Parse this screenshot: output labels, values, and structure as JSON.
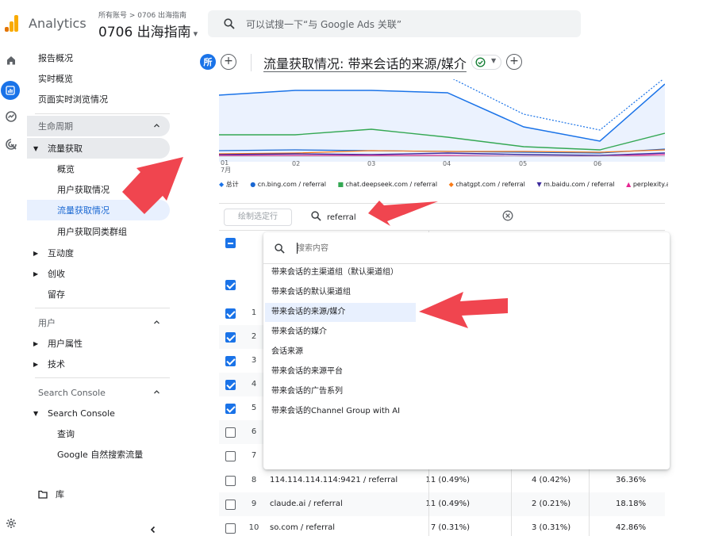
{
  "header": {
    "app_name": "Analytics",
    "breadcrumb": "所有账号 > 0706 出海指南",
    "property": "0706 出海指南",
    "search_placeholder": "可以试搜一下“与 Google Ads 关联”"
  },
  "rail": {
    "icons": [
      "home-icon",
      "reports-icon",
      "explore-icon",
      "advertising-icon"
    ],
    "settings_icon": "gear-icon"
  },
  "nav": {
    "items": [
      {
        "label": "报告概况"
      },
      {
        "label": "实时概览"
      },
      {
        "label": "页面实时浏览情况"
      },
      {
        "label": "生命周期"
      },
      {
        "label": "流量获取"
      },
      {
        "label": "概览"
      },
      {
        "label": "用户获取情况"
      },
      {
        "label": "流量获取情况"
      },
      {
        "label": "用户获取同类群组"
      },
      {
        "label": "互动度"
      },
      {
        "label": "创收"
      },
      {
        "label": "留存"
      },
      {
        "label": "用户"
      },
      {
        "label": "用户属性"
      },
      {
        "label": "技术"
      },
      {
        "label": "Search Console"
      },
      {
        "label": "Search Console"
      },
      {
        "label": "查询"
      },
      {
        "label": "Google 自然搜索流量"
      },
      {
        "label": "库"
      }
    ],
    "collapse_icon": "chevron-left-icon"
  },
  "report": {
    "badge": "所",
    "title": "流量获取情况: 带来会话的来源/媒介"
  },
  "chart_data": {
    "type": "line",
    "x": [
      "01\n7月",
      "02",
      "03",
      "04",
      "05",
      "06"
    ],
    "tick_labels": [
      "01",
      "7月",
      "02",
      "03",
      "04",
      "05",
      "06"
    ],
    "legend": [
      {
        "name": "总计",
        "color": "#1a73e8",
        "marker": "diamond"
      },
      {
        "name": "cn.bing.com / referral",
        "color": "#1967d2",
        "marker": "circle"
      },
      {
        "name": "chat.deepseek.com / referral",
        "color": "#34a853",
        "marker": "square"
      },
      {
        "name": "chatgpt.com / referral",
        "color": "#fa7b17",
        "marker": "diamond"
      },
      {
        "name": "m.baidu.com / referral",
        "color": "#3d2b9c",
        "marker": "triangle-down"
      },
      {
        "name": "perplexity.ai / re",
        "color": "#e52592",
        "marker": "triangle-up"
      }
    ]
  },
  "table": {
    "plot_button": "绘制选定行",
    "search_value": "referral",
    "header_checkbox_state": "indeterminate",
    "rows": [
      {
        "n": "1",
        "checked": true
      },
      {
        "n": "2",
        "checked": true
      },
      {
        "n": "3",
        "checked": true
      },
      {
        "n": "4",
        "checked": true
      },
      {
        "n": "5",
        "checked": true
      },
      {
        "n": "6",
        "checked": false
      },
      {
        "n": "7",
        "checked": false
      },
      {
        "n": "8",
        "checked": false,
        "name": "114.114.114.114:9421 / referral",
        "c1": "11 (0.49%)",
        "c2": "4 (0.42%)",
        "c3": "36.36%"
      },
      {
        "n": "9",
        "checked": false,
        "name": "claude.ai / referral",
        "c1": "11 (0.49%)",
        "c2": "2 (0.21%)",
        "c3": "18.18%"
      },
      {
        "n": "10",
        "checked": false,
        "name": "so.com / referral",
        "c1": "7 (0.31%)",
        "c2": "3 (0.31%)",
        "c3": "42.86%"
      }
    ]
  },
  "dimension_dropdown": {
    "search_placeholder": "搜索内容",
    "options": [
      {
        "label": "带来会话的主渠道组（默认渠道组）"
      },
      {
        "label": "带来会话的默认渠道组"
      },
      {
        "label": "带来会话的来源/媒介"
      },
      {
        "label": "带来会话的媒介"
      },
      {
        "label": "会话来源"
      },
      {
        "label": "带来会话的来源平台"
      },
      {
        "label": "带来会话的广告系列"
      },
      {
        "label": "带来会话的Channel Group with AI"
      }
    ],
    "hovered": "带来会话的来源/媒介"
  },
  "colors": {
    "accent": "#1a73e8",
    "annotation_arrow": "#f0454f",
    "selected_nav_bg": "#e8f0fe"
  }
}
